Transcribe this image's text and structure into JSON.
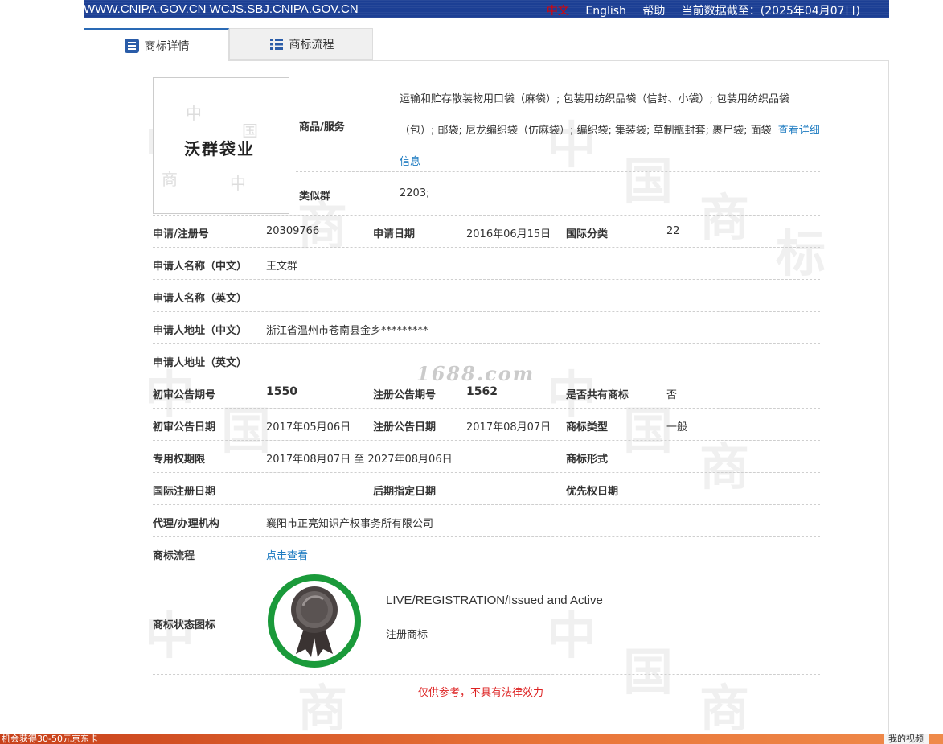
{
  "header": {
    "sites": "WWW.CNIPA.GOV.CN WCJS.SBJ.CNIPA.GOV.CN",
    "lang_zh": "中文",
    "lang_en": "English",
    "help": "帮助",
    "data_date": "当前数据截至：(2025年04月07日)"
  },
  "tabs": [
    {
      "label": "商标详情",
      "icon": "document-list-icon"
    },
    {
      "label": "商标流程",
      "icon": "list-icon"
    }
  ],
  "logo": {
    "text": "沃群袋业"
  },
  "fields": {
    "goods_label": "商品/服务",
    "goods_value": "运输和贮存散装物用口袋（麻袋）; 包装用纺织品袋（信封、小袋）; 包装用纺织品袋（包）; 邮袋; 尼龙编织袋（仿麻袋）; 编织袋; 集装袋; 草制瓶封套; 裹尸袋; 面袋",
    "goods_link": "查看详细信息",
    "similar_label": "类似群",
    "similar_value": "2203;",
    "reg_no_label": "申请/注册号",
    "reg_no_value": "20309766",
    "app_date_label": "申请日期",
    "app_date_value": "2016年06月15日",
    "intl_class_label": "国际分类",
    "intl_class_value": "22",
    "applicant_cn_label": "申请人名称（中文）",
    "applicant_cn_value": "王文群",
    "applicant_en_label": "申请人名称（英文）",
    "address_cn_label": "申请人地址（中文）",
    "address_cn_value": "浙江省温州市苍南县金乡*********",
    "address_en_label": "申请人地址（英文）",
    "prelim_no_label": "初审公告期号",
    "prelim_no_value": "1550",
    "reg_notice_no_label": "注册公告期号",
    "reg_notice_no_value": "1562",
    "shared_label": "是否共有商标",
    "shared_value": "否",
    "prelim_date_label": "初审公告日期",
    "prelim_date_value": "2017年05月06日",
    "reg_notice_date_label": "注册公告日期",
    "reg_notice_date_value": "2017年08月07日",
    "mark_type_label": "商标类型",
    "mark_type_value": "一般",
    "term_label": "专用权期限",
    "term_value": "2017年08月07日 至 2027年08月06日",
    "mark_form_label": "商标形式",
    "intl_reg_date_label": "国际注册日期",
    "later_date_label": "后期指定日期",
    "priority_date_label": "优先权日期",
    "agent_label": "代理/办理机构",
    "agent_value": "襄阳市正亮知识产权事务所有限公司",
    "flow_label": "商标流程",
    "flow_link": "点击查看",
    "status_label": "商标状态图标",
    "status_en": "LIVE/REGISTRATION/Issued and Active",
    "status_zh": "注册商标"
  },
  "disclaimer": "仅供参考，不具有法律效力",
  "overlay_watermark": "1688.com",
  "bottom_bar": {
    "left_text": "机会获得30-50元京东卡",
    "right_text": "我的视频"
  },
  "colors": {
    "topbar": "#1c3f94",
    "link": "#1d7bc1",
    "disclaimer": "#dd2222",
    "seal_ring": "#1a9a3a"
  }
}
